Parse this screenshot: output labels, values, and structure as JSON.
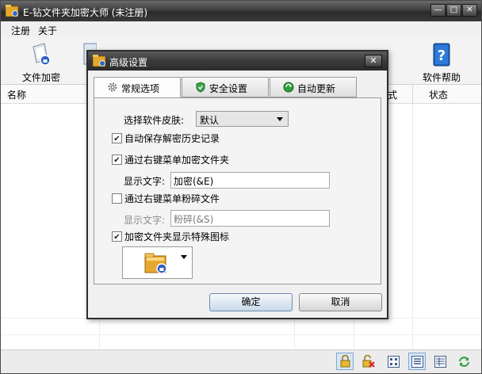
{
  "window": {
    "title": "E-钻文件夹加密大师 (未注册)"
  },
  "menu": {
    "items": [
      "注册",
      "关于"
    ]
  },
  "toolbar": {
    "items": [
      {
        "label": "文件加密",
        "icon": "lock-file-icon"
      },
      {
        "label": "软件帮助",
        "icon": "help-book-icon"
      }
    ]
  },
  "list": {
    "columns": [
      "名称",
      "式",
      "状态"
    ]
  },
  "dialog": {
    "title": "高级设置",
    "tabs": [
      {
        "label": "常规选项",
        "icon": "gear-icon"
      },
      {
        "label": "安全设置",
        "icon": "shield-icon"
      },
      {
        "label": "自动更新",
        "icon": "update-icon"
      }
    ],
    "skin": {
      "label": "选择软件皮肤:",
      "value": "默认"
    },
    "options": {
      "save_history": {
        "label": "自动保存解密历史记录",
        "checked": true
      },
      "context_encrypt": {
        "label": "通过右键菜单加密文件夹",
        "checked": true
      },
      "encrypt_text_label": "显示文字:",
      "encrypt_text_value": "加密(&E)",
      "context_shred": {
        "label": "通过右键菜单粉碎文件",
        "checked": false
      },
      "shred_text_label": "显示文字:",
      "shred_text_value": "粉碎(&S)",
      "special_icon": {
        "label": "加密文件夹显示特殊图标",
        "checked": true
      }
    },
    "buttons": {
      "ok": "确定",
      "cancel": "取消"
    }
  },
  "colors": {
    "titlebar": "#2a2a2a",
    "accent": "#6f8db0",
    "active_status": "#d7e6f7"
  }
}
